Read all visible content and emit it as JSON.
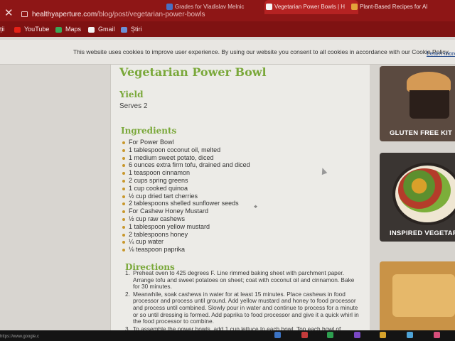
{
  "browser": {
    "tabs": [
      {
        "title": "Grades for Vladislav Melnic"
      },
      {
        "title": "Vegetarian Power Bowls | H"
      },
      {
        "title": "Plant-Based Recipes for Al"
      }
    ],
    "url_domain": "healthyaperture.com",
    "url_path": "/blog/post/vegetarian-power-bowls",
    "bookmarks": [
      "ții",
      "YouTube",
      "Maps",
      "Gmail",
      "Știri"
    ],
    "status_url": "https://www.google.c"
  },
  "cookie_banner": {
    "text": "This website uses cookies to improve user experience. By using our website you consent to all cookies in accordance with our Cookie Policy.",
    "link": "Learn more"
  },
  "recipe": {
    "title": "Vegetarian Power Bowl",
    "yield_heading": "Yield",
    "yield_value": "Serves 2",
    "ingredients_heading": "Ingredients",
    "ingredients": [
      "For Power Bowl",
      "1 tablespoon coconut oil, melted",
      "1 medium sweet potato, diced",
      "6 ounces extra firm tofu, drained and diced",
      "1 teaspoon cinnamon",
      "2 cups spring greens",
      "1 cup cooked quinoa",
      "½ cup dried tart cherries",
      "2 tablespoons shelled sunflower seeds",
      "For Cashew Honey Mustard",
      "½ cup raw cashews",
      "1 tablespoon yellow mustard",
      "2 tablespoons honey",
      "¼ cup water",
      "⅛ teaspoon paprika"
    ],
    "directions_heading": "Directions",
    "directions": [
      "Preheat oven to 425 degrees F. Line rimmed baking sheet with parchment paper. Arrange tofu and sweet potatoes on sheet; coat with coconut oil and cinnamon. Bake for 30 minutes.",
      "Meanwhile, soak cashews in water for at least 15 minutes. Place cashews in food processor and process until ground. Add yellow mustard and honey to food processor and process until combined. Slowly pour in water and continue to process for a minute or so until dressing is formed. Add paprika to food processor and give it a quick whirl in the food processor to combine.",
      "To assemble the power bowls, add 1 cup lettuce to each bowl. Top each bowl of"
    ]
  },
  "sidebar_cards": [
    {
      "label": "GLUTEN FREE KIT"
    },
    {
      "label": "INSPIRED VEGETAR"
    },
    {
      "label": ""
    }
  ],
  "colors": {
    "browser_red": "#8e1616",
    "heading_green": "#7aa83a",
    "bullet_gold": "#c8972b"
  }
}
